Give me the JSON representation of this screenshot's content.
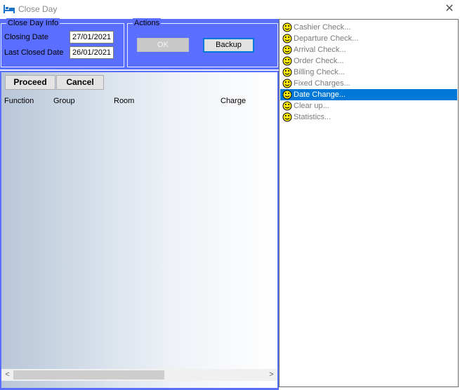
{
  "window": {
    "title": "Close Day",
    "close_glyph": "✕",
    "app_icon": "bed-icon"
  },
  "close_day_info": {
    "legend": "Close Day Info",
    "closing_date_label": "Closing Date",
    "closing_date_value": "27/01/2021",
    "last_closed_date_label": "Last Closed Date",
    "last_closed_date_value": "26/01/2021"
  },
  "actions": {
    "legend": "Actions",
    "ok_label": "OK",
    "ok_enabled": false,
    "backup_label": "Backup"
  },
  "grid": {
    "proceed_label": "Proceed",
    "cancel_label": "Cancel",
    "columns": [
      "Function",
      "Group",
      "Room",
      "Charge"
    ],
    "rows": []
  },
  "scrollbar": {
    "left_arrow": "<",
    "right_arrow": ">"
  },
  "checklist": {
    "item_icon": "smiley-face-icon",
    "selected_index": 6,
    "items": [
      "Cashier Check...",
      "Departure Check...",
      "Arrival Check...",
      "Order Check...",
      "Billing Check...",
      "Fixed Charges...",
      "Date Change...",
      "Clear up...",
      "Statistics..."
    ]
  },
  "colors": {
    "panel_blue": "#5a6eff",
    "selection_blue": "#0078d7",
    "face_yellow": "#ffee00"
  }
}
